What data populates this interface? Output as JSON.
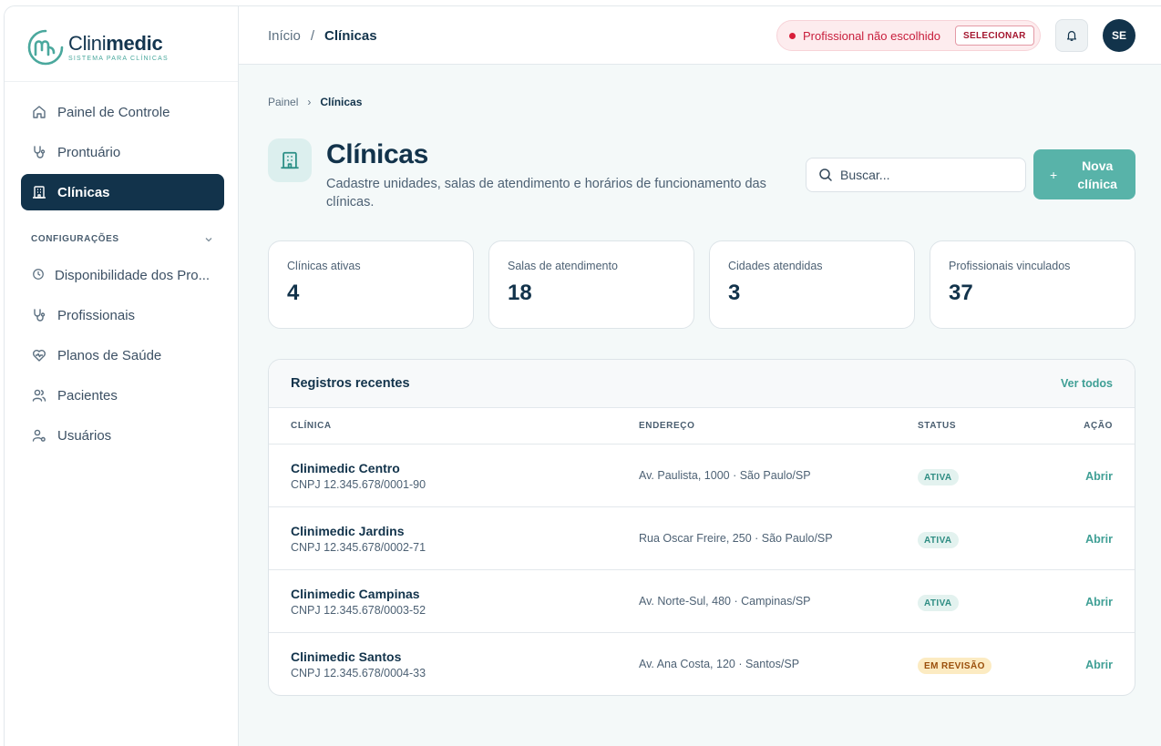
{
  "brand": {
    "name_light": "Clini",
    "name_bold": "medic",
    "tagline": "SISTEMA PARA CLÍNICAS",
    "accent": "#58b3a9",
    "navy": "#12334b"
  },
  "sidebar": {
    "main_items": [
      {
        "label": "Painel de Controle",
        "icon": "home-icon",
        "active": false
      },
      {
        "label": "Prontuário",
        "icon": "stethoscope-icon",
        "active": false
      },
      {
        "label": "Clínicas",
        "icon": "building-icon",
        "active": true
      }
    ],
    "section_label": "CONFIGURAÇÕES",
    "config_items": [
      {
        "label": "Disponibilidade dos Pro...",
        "icon": "clock-icon"
      },
      {
        "label": "Profissionais",
        "icon": "stethoscope-icon"
      },
      {
        "label": "Planos de Saúde",
        "icon": "heart-pulse-icon"
      },
      {
        "label": "Pacientes",
        "icon": "users-icon"
      },
      {
        "label": "Usuários",
        "icon": "user-cog-icon"
      }
    ]
  },
  "topbar": {
    "breadcrumb": {
      "home": "Início",
      "sep": "/",
      "current": "Clínicas"
    },
    "professional_status": "Profissional não escolhido",
    "select_label": "SELECIONAR",
    "avatar_initials": "SE"
  },
  "page": {
    "breadcrumb": {
      "root": "Painel",
      "sep": "›",
      "current": "Clínicas"
    },
    "title": "Clínicas",
    "subtitle": "Cadastre unidades, salas de atendimento e horários de funcionamento das clínicas.",
    "search_placeholder": "Buscar...",
    "new_button_plus": "+",
    "new_button": "Nova clínica"
  },
  "stats": [
    {
      "label": "Clínicas ativas",
      "value": "4"
    },
    {
      "label": "Salas de atendimento",
      "value": "18"
    },
    {
      "label": "Cidades atendidas",
      "value": "3"
    },
    {
      "label": "Profissionais vinculados",
      "value": "37"
    }
  ],
  "recent": {
    "title": "Registros recentes",
    "see_all": "Ver todos",
    "columns": {
      "clinic": "CLÍNICA",
      "address": "ENDEREÇO",
      "status": "STATUS",
      "action": "AÇÃO"
    },
    "rows": [
      {
        "name": "Clinimedic Centro",
        "cnpj": "CNPJ 12.345.678/0001-90",
        "address": "Av. Paulista, 1000 · São Paulo/SP",
        "status": "ATIVA",
        "status_kind": "ativa",
        "action": "Abrir"
      },
      {
        "name": "Clinimedic Jardins",
        "cnpj": "CNPJ 12.345.678/0002-71",
        "address": "Rua Oscar Freire, 250 · São Paulo/SP",
        "status": "ATIVA",
        "status_kind": "ativa",
        "action": "Abrir"
      },
      {
        "name": "Clinimedic Campinas",
        "cnpj": "CNPJ 12.345.678/0003-52",
        "address": "Av. Norte-Sul, 480 · Campinas/SP",
        "status": "ATIVA",
        "status_kind": "ativa",
        "action": "Abrir"
      },
      {
        "name": "Clinimedic Santos",
        "cnpj": "CNPJ 12.345.678/0004-33",
        "address": "Av. Ana Costa, 120 · Santos/SP",
        "status": "EM REVISÃO",
        "status_kind": "revisao",
        "action": "Abrir"
      }
    ]
  }
}
